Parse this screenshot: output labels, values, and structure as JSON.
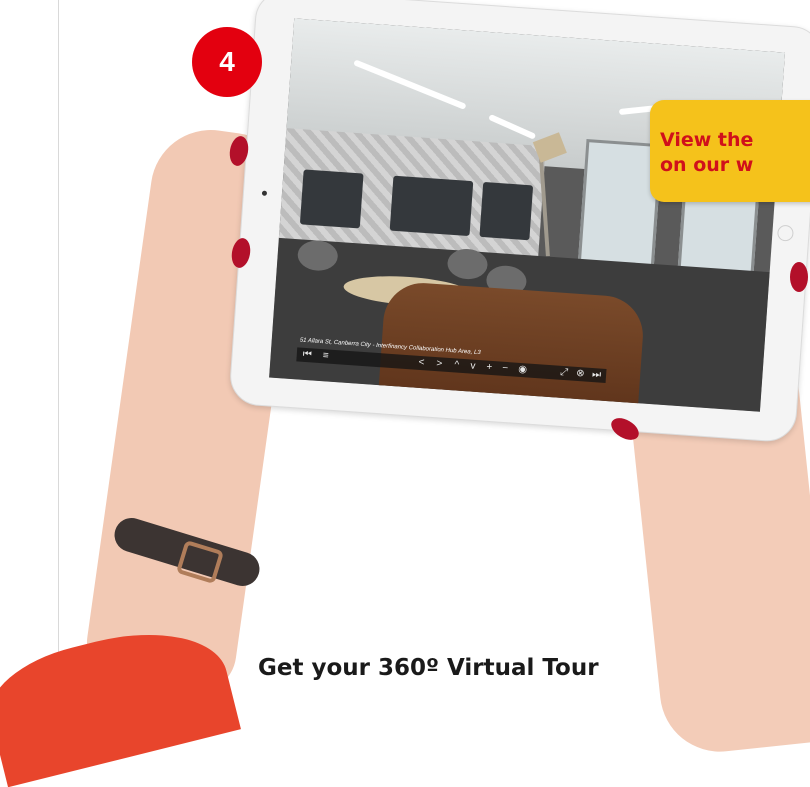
{
  "step_badge": "4",
  "callout": {
    "line1": "View the",
    "line2": "on our w"
  },
  "tour": {
    "caption": "51 Allara St, Canberra City - Interfinancy Collaboration Hub Area, L3",
    "toolbar": {
      "first": "⏮",
      "menu": "≡",
      "left": "<",
      "right": ">",
      "up": "^",
      "down": "v",
      "zoom_in": "+",
      "zoom_out": "−",
      "view": "◉",
      "fullscreen": "⤢",
      "close": "⊗",
      "last": "⏭"
    }
  },
  "cta": "Get your 360º Virtual Tour",
  "colors": {
    "badge": "#e3000f",
    "callout_bg": "#f5c21b",
    "callout_text": "#d0101b"
  }
}
